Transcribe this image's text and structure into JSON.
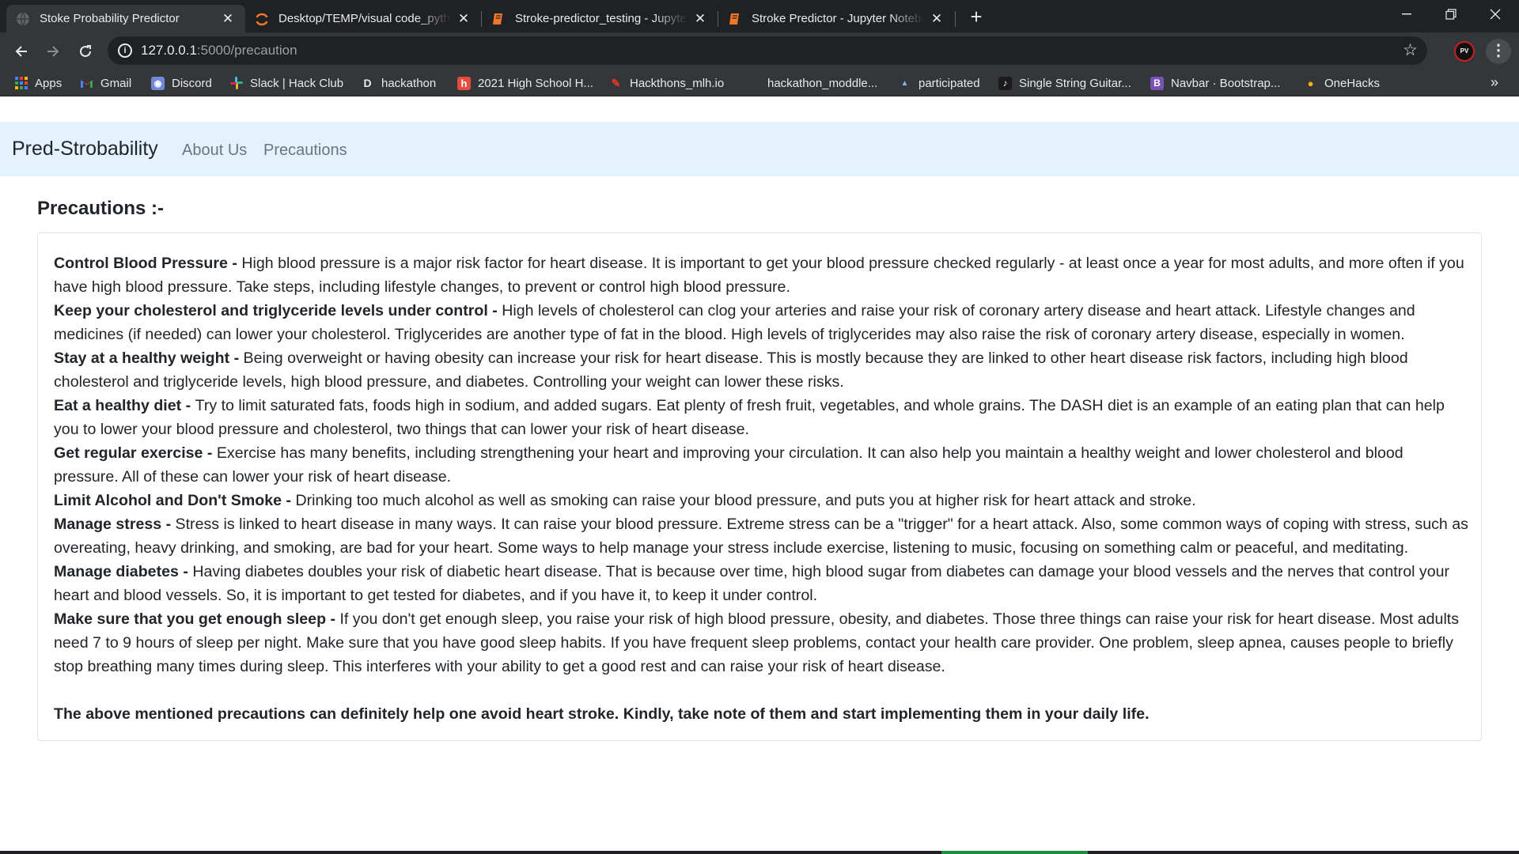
{
  "browser": {
    "tabs": [
      {
        "title": "Stoke Probability Predictor",
        "active": true,
        "icon": "globe-icon"
      },
      {
        "title": "Desktop/TEMP/visual code_python",
        "active": false,
        "icon": "jupyter-icon"
      },
      {
        "title": "Stroke-predictor_testing - Jupyter",
        "active": false,
        "icon": "notebook-icon"
      },
      {
        "title": "Stroke Predictor - Jupyter Notebook",
        "active": false,
        "icon": "notebook-icon"
      }
    ],
    "address": {
      "host": "127.0.0.1",
      "path": ":5000/precaution"
    },
    "profile_initials": "PV",
    "bookmarks": [
      {
        "label": "Apps",
        "icon": "apps-grid-icon"
      },
      {
        "label": "Gmail",
        "icon": "gmail-icon"
      },
      {
        "label": "Discord",
        "icon": "discord-icon"
      },
      {
        "label": "Slack | Hack Club",
        "icon": "slack-icon"
      },
      {
        "label": "hackathon",
        "icon": "devpost-icon"
      },
      {
        "label": "2021 High School H...",
        "icon": "hackerearth-icon"
      },
      {
        "label": "Hackthons_mlh.io",
        "icon": "mlh-icon"
      },
      {
        "label": "hackathon_moddle...",
        "icon": "blank-icon"
      },
      {
        "label": "participated",
        "icon": "cloud-icon"
      },
      {
        "label": "Single String Guitar...",
        "icon": "guitar-icon"
      },
      {
        "label": "Navbar · Bootstrap...",
        "icon": "bootstrap-icon"
      },
      {
        "label": "OneHacks",
        "icon": "onehacks-icon"
      }
    ]
  },
  "navbar": {
    "brand": "Pred-Strobability",
    "links": [
      "About Us",
      "Precautions"
    ]
  },
  "page": {
    "title": "Precautions :-",
    "precautions": [
      {
        "heading": "Control Blood Pressure - ",
        "text": "High blood pressure is a major risk factor for heart disease. It is important to get your blood pressure checked regularly - at least once a year for most adults, and more often if you have high blood pressure. Take steps, including lifestyle changes, to prevent or control high blood pressure."
      },
      {
        "heading": "Keep your cholesterol and triglyceride levels under control - ",
        "text": "High levels of cholesterol can clog your arteries and raise your risk of coronary artery disease and heart attack. Lifestyle changes and medicines (if needed) can lower your cholesterol. Triglycerides are another type of fat in the blood. High levels of triglycerides may also raise the risk of coronary artery disease, especially in women."
      },
      {
        "heading": "Stay at a healthy weight - ",
        "text": "Being overweight or having obesity can increase your risk for heart disease. This is mostly because they are linked to other heart disease risk factors, including high blood cholesterol and triglyceride levels, high blood pressure, and diabetes. Controlling your weight can lower these risks."
      },
      {
        "heading": "Eat a healthy diet - ",
        "text": "Try to limit saturated fats, foods high in sodium, and added sugars. Eat plenty of fresh fruit, vegetables, and whole grains. The DASH diet is an example of an eating plan that can help you to lower your blood pressure and cholesterol, two things that can lower your risk of heart disease."
      },
      {
        "heading": "Get regular exercise - ",
        "text": "Exercise has many benefits, including strengthening your heart and improving your circulation. It can also help you maintain a healthy weight and lower cholesterol and blood pressure. All of these can lower your risk of heart disease."
      },
      {
        "heading": "Limit Alcohol and Don't Smoke - ",
        "text": "Drinking too much alcohol as well as smoking can raise your blood pressure, and puts you at higher risk for heart attack and stroke."
      },
      {
        "heading": "Manage stress - ",
        "text": "Stress is linked to heart disease in many ways. It can raise your blood pressure. Extreme stress can be a \"trigger\" for a heart attack. Also, some common ways of coping with stress, such as overeating, heavy drinking, and smoking, are bad for your heart. Some ways to help manage your stress include exercise, listening to music, focusing on something calm or peaceful, and meditating."
      },
      {
        "heading": "Manage diabetes - ",
        "text": "Having diabetes doubles your risk of diabetic heart disease. That is because over time, high blood sugar from diabetes can damage your blood vessels and the nerves that control your heart and blood vessels. So, it is important to get tested for diabetes, and if you have it, to keep it under control."
      },
      {
        "heading": "Make sure that you get enough sleep - ",
        "text": "If you don't get enough sleep, you raise your risk of high blood pressure, obesity, and diabetes. Those three things can raise your risk for heart disease. Most adults need 7 to 9 hours of sleep per night. Make sure that you have good sleep habits. If you have frequent sleep problems, contact your health care provider. One problem, sleep apnea, causes people to briefly stop breathing many times during sleep. This interferes with your ability to get a good rest and can raise your risk of heart disease."
      }
    ],
    "closing": "The above mentioned precautions can definitely help one avoid heart stroke. Kindly, take note of them and start implementing them in your daily life."
  }
}
